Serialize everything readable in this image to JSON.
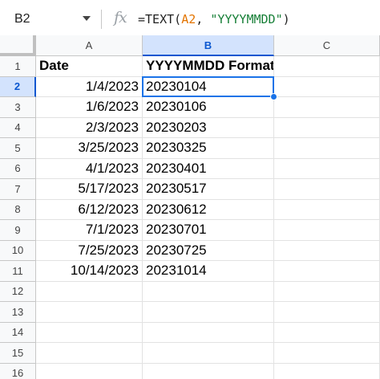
{
  "formula_bar": {
    "name_box": "B2",
    "fx_label": "fx",
    "formula_prefix": "=TEXT(",
    "formula_ref": "A2",
    "formula_sep": ", ",
    "formula_string": "\"YYYYMMDD\"",
    "formula_suffix": ")"
  },
  "columns": [
    "A",
    "B",
    "C"
  ],
  "active_column": "B",
  "active_row": "2",
  "rows": [
    {
      "num": "1",
      "a": "Date",
      "b": "YYYYMMDD Format"
    },
    {
      "num": "2",
      "a": "1/4/2023",
      "b": "20230104"
    },
    {
      "num": "3",
      "a": "1/6/2023",
      "b": "20230106"
    },
    {
      "num": "4",
      "a": "2/3/2023",
      "b": "20230203"
    },
    {
      "num": "5",
      "a": "3/25/2023",
      "b": "20230325"
    },
    {
      "num": "6",
      "a": "4/1/2023",
      "b": "20230401"
    },
    {
      "num": "7",
      "a": "5/17/2023",
      "b": "20230517"
    },
    {
      "num": "8",
      "a": "6/12/2023",
      "b": "20230612"
    },
    {
      "num": "9",
      "a": "7/1/2023",
      "b": "20230701"
    },
    {
      "num": "10",
      "a": "7/25/2023",
      "b": "20230725"
    },
    {
      "num": "11",
      "a": "10/14/2023",
      "b": "20231014"
    },
    {
      "num": "12",
      "a": "",
      "b": ""
    },
    {
      "num": "13",
      "a": "",
      "b": ""
    },
    {
      "num": "14",
      "a": "",
      "b": ""
    },
    {
      "num": "15",
      "a": "",
      "b": ""
    },
    {
      "num": "16",
      "a": "",
      "b": ""
    }
  ],
  "colors": {
    "selection": "#1a73e8",
    "header_active_bg": "#d3e3fd",
    "ref_color": "#e37400",
    "string_color": "#188038"
  }
}
